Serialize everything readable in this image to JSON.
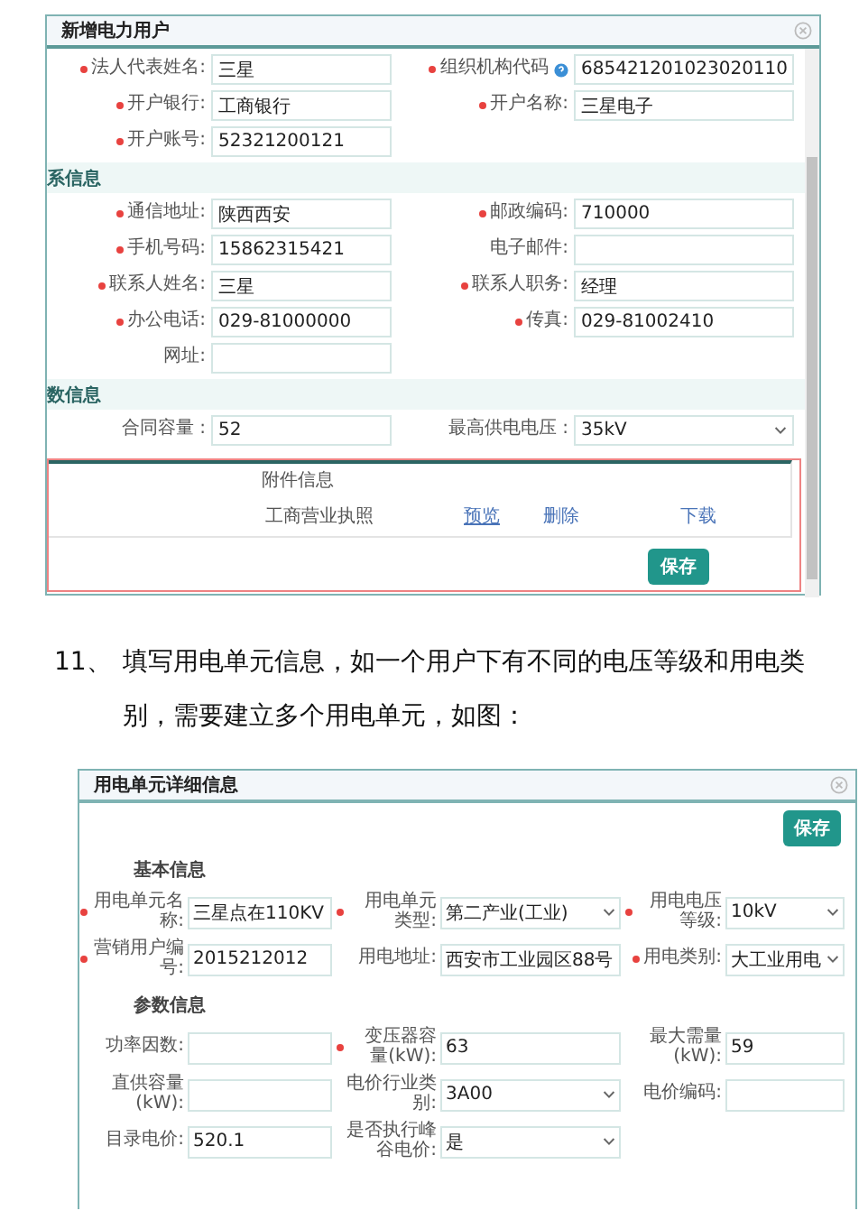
{
  "user_dialog": {
    "title": "新增电力用户",
    "blocks": [
      {
        "kind": "fields",
        "rows": [
          [
            {
              "label": "法人代表姓名:",
              "required": true,
              "help": false,
              "kind": "text",
              "value": "三星"
            },
            {
              "label": "组织机构代码",
              "required": true,
              "help": true,
              "kind": "text",
              "value": "685421201023020110"
            }
          ],
          [
            {
              "label": "开户银行:",
              "required": true,
              "help": false,
              "kind": "text",
              "value": "工商银行"
            },
            {
              "label": "开户名称:",
              "required": true,
              "help": false,
              "kind": "text",
              "value": "三星电子"
            }
          ],
          [
            {
              "label": "开户账号:",
              "required": true,
              "help": false,
              "kind": "text",
              "value": "52321200121"
            }
          ]
        ]
      },
      {
        "kind": "heading",
        "text": "系信息"
      },
      {
        "kind": "fields",
        "rows": [
          [
            {
              "label": "通信地址:",
              "required": true,
              "help": false,
              "kind": "text",
              "value": "陕西西安"
            },
            {
              "label": "邮政编码:",
              "required": true,
              "help": false,
              "kind": "text",
              "value": "710000"
            }
          ],
          [
            {
              "label": "手机号码:",
              "required": true,
              "help": false,
              "kind": "text",
              "value": "15862315421"
            },
            {
              "label": "电子邮件:",
              "required": false,
              "help": false,
              "kind": "text"
            }
          ],
          [
            {
              "label": "联系人姓名:",
              "required": true,
              "help": false,
              "kind": "text",
              "value": "三星"
            },
            {
              "label": "联系人职务:",
              "required": true,
              "help": false,
              "kind": "text",
              "value": "经理"
            }
          ],
          [
            {
              "label": "办公电话:",
              "required": true,
              "help": false,
              "kind": "text",
              "value": "029-81000000"
            },
            {
              "label": "传真:",
              "required": true,
              "help": false,
              "kind": "text",
              "value": "029-81002410"
            }
          ],
          [
            {
              "label": "网址:",
              "required": false,
              "help": false,
              "kind": "text"
            }
          ]
        ]
      },
      {
        "kind": "heading",
        "text": "数信息"
      },
      {
        "kind": "fields",
        "rows": [
          [
            {
              "label": "合同容量 :",
              "required": false,
              "help": false,
              "kind": "text",
              "value": "52"
            },
            {
              "label": "最高供电电压 :",
              "required": false,
              "help": false,
              "kind": "select",
              "value": "35kV"
            }
          ]
        ]
      }
    ],
    "attachments": {
      "title": "附件信息",
      "rows": [
        {
          "name": "工商营业执照",
          "links": [
            "预览",
            "删除",
            "下载"
          ]
        }
      ]
    },
    "save_button": "保存"
  },
  "instruction": {
    "number": "11、",
    "text": "填写用电单元信息，如一个用户下有不同的电压等级和用电类别，需要建立多个用电单元，如图："
  },
  "unit_dialog": {
    "title": "用电单元详细信息",
    "save_button": "保存",
    "sections": [
      {
        "heading": "基本信息",
        "rows": [
          [
            {
              "label": "用电单元名称:",
              "required": true,
              "kind": "text",
              "value": "三星点在110KV"
            },
            {
              "label": "用电单元类型:",
              "required": true,
              "kind": "select",
              "value": "第二产业(工业)"
            },
            {
              "label": "用电电压等级:",
              "required": true,
              "kind": "select",
              "value": "10kV"
            }
          ],
          [
            {
              "label": "营销用户编号:",
              "required": true,
              "kind": "text",
              "value": "2015212012"
            },
            {
              "label": "用电地址:",
              "required": false,
              "kind": "text",
              "value": "西安市工业园区88号"
            },
            {
              "label": "用电类别:",
              "required": true,
              "kind": "select",
              "value": "大工业用电"
            }
          ]
        ]
      },
      {
        "heading": "参数信息",
        "rows": [
          [
            {
              "label": "功率因数:",
              "required": false,
              "kind": "text"
            },
            {
              "label": "变压器容量(kW):",
              "required": true,
              "kind": "text",
              "value": "63"
            },
            {
              "label": "最大需量(kW):",
              "required": false,
              "kind": "text",
              "value": "59"
            }
          ],
          [
            {
              "label": "直供容量(kW):",
              "required": false,
              "kind": "text"
            },
            {
              "label": "电价行业类别:",
              "required": false,
              "kind": "select",
              "value": "3A00"
            },
            {
              "label": "电价编码:",
              "required": false,
              "kind": "text"
            }
          ],
          [
            {
              "label": "目录电价:",
              "required": false,
              "kind": "text",
              "value": "520.1"
            },
            {
              "label": "是否执行峰谷电价:",
              "required": false,
              "kind": "select",
              "value": "是"
            }
          ]
        ]
      }
    ]
  }
}
